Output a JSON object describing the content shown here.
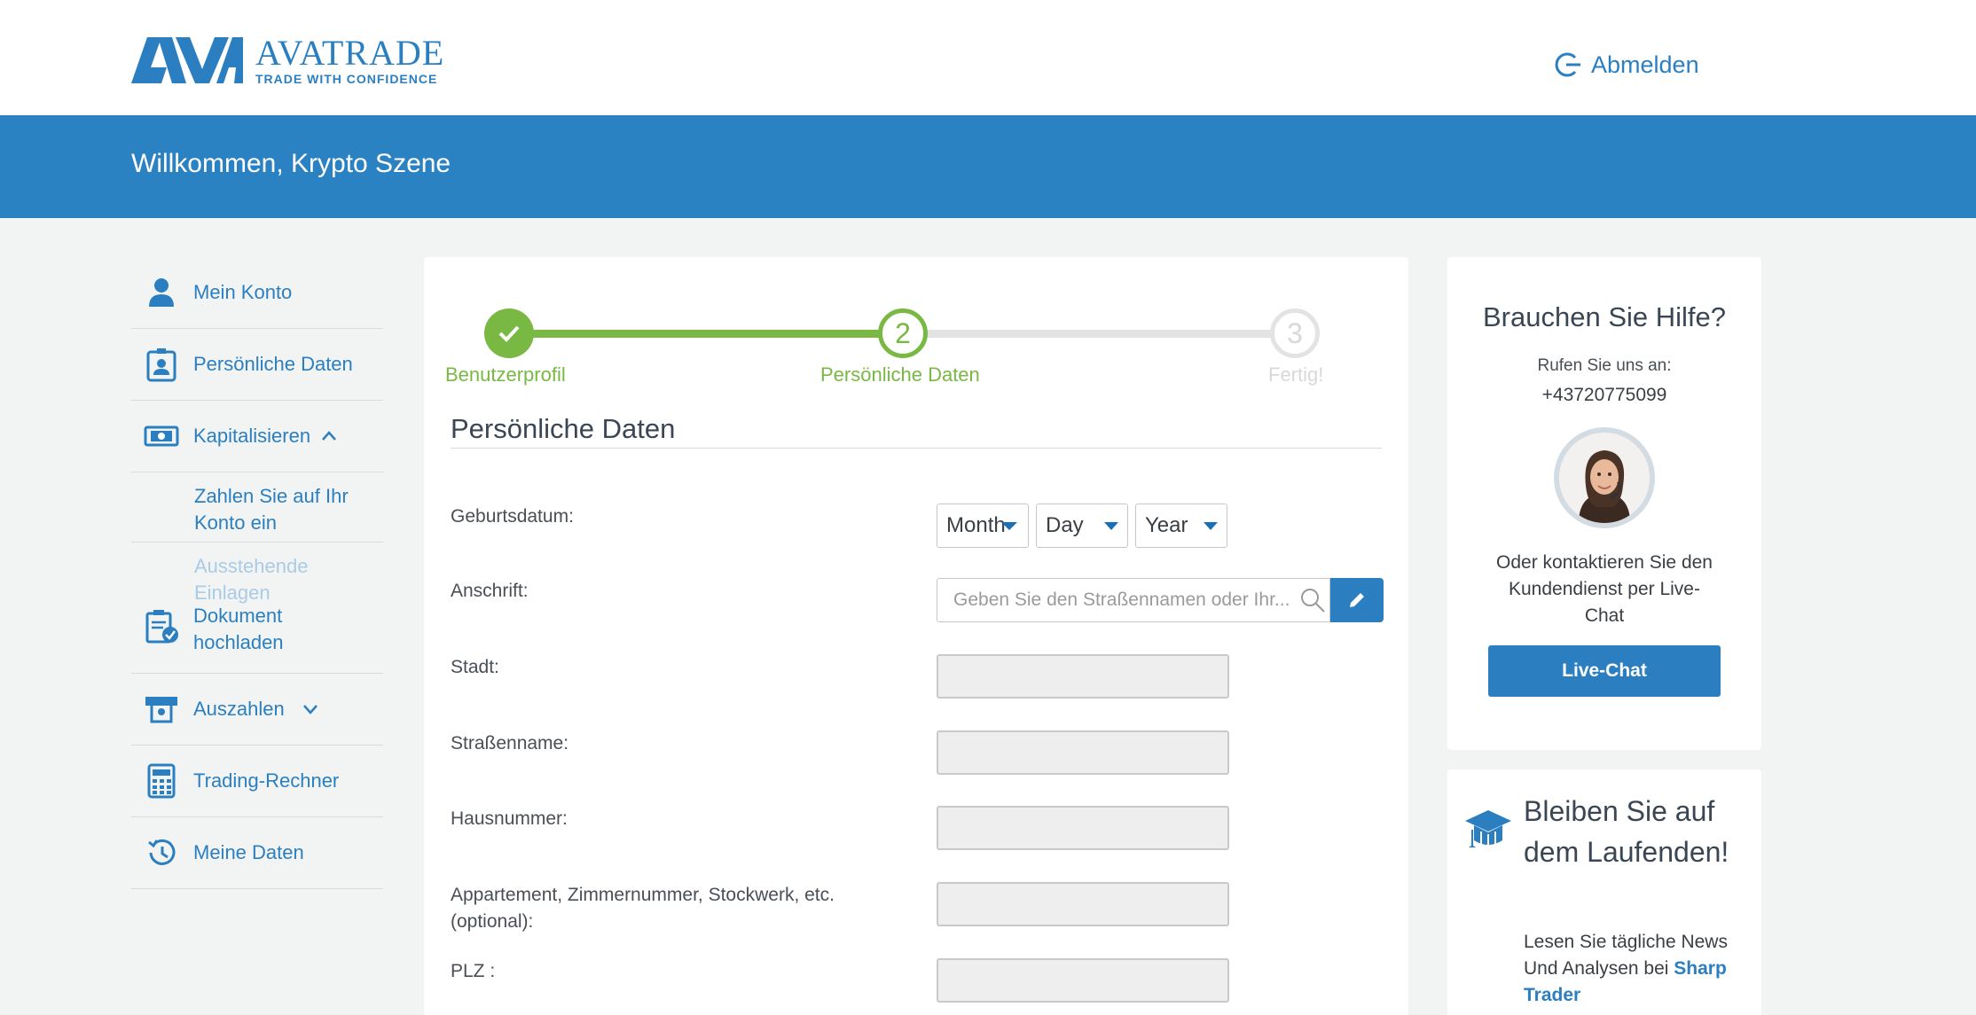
{
  "header": {
    "logo_name": "AVATRADE",
    "logo_tagline": "TRADE WITH CONFIDENCE",
    "logout_label": "Abmelden"
  },
  "welcome": {
    "text": "Willkommen, Krypto Szene"
  },
  "sidebar": {
    "items": [
      {
        "label": "Mein Konto",
        "icon": "user-icon"
      },
      {
        "label": "Persönliche Daten",
        "icon": "id-badge-icon"
      },
      {
        "label": "Kapitalisieren",
        "icon": "banknote-icon"
      },
      {
        "label": "Zahlen Sie auf Ihr Konto ein"
      },
      {
        "label": "Ausstehende Einlagen"
      },
      {
        "label": "Dokument hochladen",
        "icon": "clipboard-check-icon"
      },
      {
        "label": "Auszahlen",
        "icon": "withdraw-icon"
      },
      {
        "label": "Trading-Rechner",
        "icon": "calculator-icon"
      },
      {
        "label": "Meine Daten",
        "icon": "history-icon"
      }
    ]
  },
  "steps": [
    {
      "number": "",
      "label": "Benutzerprofil",
      "state": "done"
    },
    {
      "number": "2",
      "label": "Persönliche Daten",
      "state": "active"
    },
    {
      "number": "3",
      "label": "Fertig!",
      "state": "pending"
    }
  ],
  "form": {
    "title": "Persönliche Daten",
    "birthdate_label": "Geburtsdatum:",
    "month": "Month",
    "day": "Day",
    "year": "Year",
    "address_label": "Anschrift:",
    "address_placeholder": "Geben Sie den Straßennamen oder Ihr...",
    "city_label": "Stadt:",
    "street_label": "Straßenname:",
    "house_label": "Hausnummer:",
    "apartment_label": "Appartement, Zimmernummer, Stockwerk, etc. (optional):",
    "zip_label": "PLZ :"
  },
  "help": {
    "title": "Brauchen Sie Hilfe?",
    "call_label": "Rufen Sie uns an:",
    "phone": "+43720775099",
    "alt_text": "Oder kontaktieren Sie den Kundendienst per Live-Chat",
    "chat_button": "Live-Chat"
  },
  "news": {
    "title": "Bleiben Sie auf dem Laufenden!",
    "text": "Lesen Sie tägliche News Und Analysen bei",
    "link": "Sharp Trader"
  },
  "colors": {
    "brand_blue": "#2b7fc0",
    "welcome_bar": "#2b82c2",
    "step_green": "#78b843",
    "step_grey": "#e3e3e3"
  }
}
